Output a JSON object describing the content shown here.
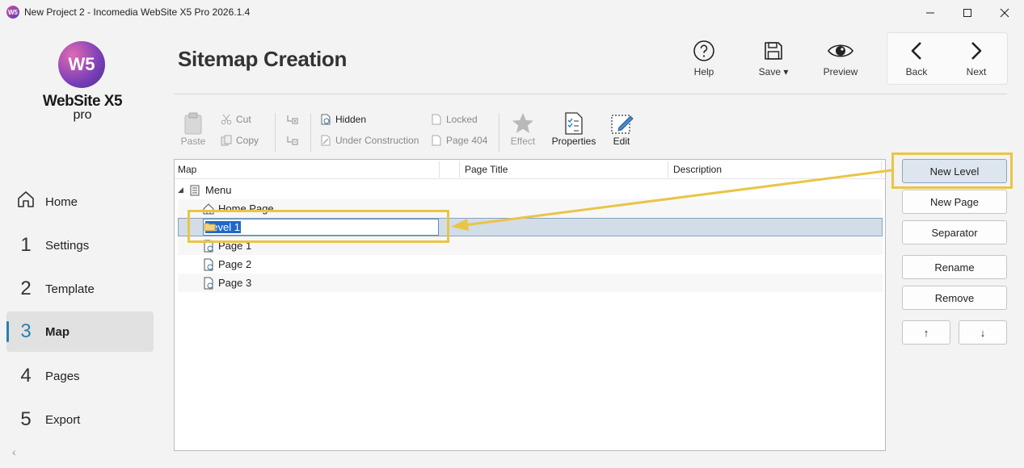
{
  "window": {
    "title": "New Project 2 - Incomedia WebSite X5 Pro 2026.1.4",
    "minimize": "—",
    "maximize": "☐",
    "close": "✕"
  },
  "brand": {
    "logo_mark": "W5",
    "name": "WebSite X5",
    "edition": "pro"
  },
  "nav": {
    "items": [
      {
        "num": "",
        "label": "Home"
      },
      {
        "num": "1",
        "label": "Settings"
      },
      {
        "num": "2",
        "label": "Template"
      },
      {
        "num": "3",
        "label": "Map"
      },
      {
        "num": "4",
        "label": "Pages"
      },
      {
        "num": "5",
        "label": "Export"
      }
    ],
    "active_index": 3,
    "collapse": "‹"
  },
  "header": {
    "title": "Sitemap Creation",
    "help": "Help",
    "save": "Save",
    "preview": "Preview",
    "back": "Back",
    "next": "Next"
  },
  "toolbar": {
    "paste": "Paste",
    "cut": "Cut",
    "copy": "Copy",
    "hidden": "Hidden",
    "under_construction": "Under Construction",
    "locked": "Locked",
    "page404": "Page 404",
    "effect": "Effect",
    "properties": "Properties",
    "edit": "Edit"
  },
  "tree": {
    "columns": [
      "Map",
      "Page Title",
      "Description"
    ],
    "root": "Menu",
    "rows": [
      {
        "label": "Home Page",
        "icon": "home-icon"
      },
      {
        "label": "Level 1",
        "icon": "folder-icon",
        "editing": true
      },
      {
        "label": "Page 1",
        "icon": "page-icon"
      },
      {
        "label": "Page 2",
        "icon": "page-icon"
      },
      {
        "label": "Page 3",
        "icon": "page-icon"
      }
    ]
  },
  "actions": {
    "new_level": "New Level",
    "new_page": "New Page",
    "separator": "Separator",
    "rename": "Rename",
    "remove": "Remove",
    "move_up": "↑",
    "move_down": "↓"
  },
  "colors": {
    "accent": "#2a7fb0",
    "highlight": "#e9c546",
    "selection": "#1f68c9"
  }
}
